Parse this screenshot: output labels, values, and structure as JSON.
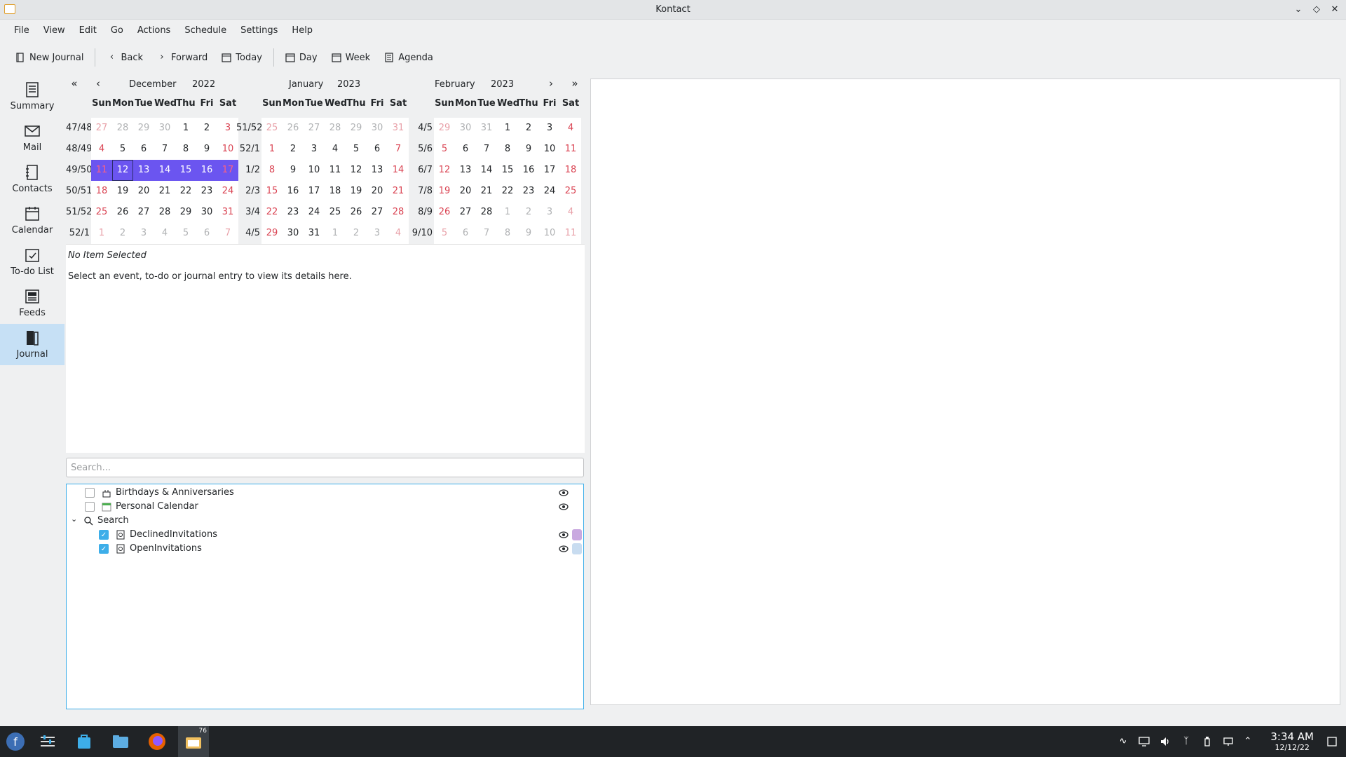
{
  "window": {
    "title": "Kontact"
  },
  "menubar": [
    "File",
    "View",
    "Edit",
    "Go",
    "Actions",
    "Schedule",
    "Settings",
    "Help"
  ],
  "toolbar": {
    "new_journal": "New Journal",
    "back": "Back",
    "forward": "Forward",
    "today": "Today",
    "day": "Day",
    "week": "Week",
    "agenda": "Agenda"
  },
  "sidebar": [
    {
      "label": "Summary",
      "icon": "summary-icon"
    },
    {
      "label": "Mail",
      "icon": "mail-icon"
    },
    {
      "label": "Contacts",
      "icon": "contacts-icon"
    },
    {
      "label": "Calendar",
      "icon": "calendar-icon"
    },
    {
      "label": "To-do List",
      "icon": "todo-icon"
    },
    {
      "label": "Feeds",
      "icon": "feeds-icon"
    },
    {
      "label": "Journal",
      "icon": "journal-icon",
      "active": true
    }
  ],
  "calendar": {
    "dow": [
      "Sun",
      "Mon",
      "Tue",
      "Wed",
      "Thu",
      "Fri",
      "Sat"
    ],
    "months": [
      {
        "month": "December",
        "year": "2022",
        "weeks": [
          "47/48",
          "48/49",
          "49/50",
          "50/51",
          "51/52",
          "52/1"
        ],
        "days": [
          [
            27,
            28,
            29,
            30,
            1,
            2,
            3
          ],
          [
            4,
            5,
            6,
            7,
            8,
            9,
            10
          ],
          [
            11,
            12,
            13,
            14,
            15,
            16,
            17
          ],
          [
            18,
            19,
            20,
            21,
            22,
            23,
            24
          ],
          [
            25,
            26,
            27,
            28,
            29,
            30,
            31
          ],
          [
            1,
            2,
            3,
            4,
            5,
            6,
            7
          ]
        ],
        "other": [
          [
            1,
            1,
            1,
            1,
            0,
            0,
            0
          ],
          [
            0,
            0,
            0,
            0,
            0,
            0,
            0
          ],
          [
            0,
            0,
            0,
            0,
            0,
            0,
            0
          ],
          [
            0,
            0,
            0,
            0,
            0,
            0,
            0
          ],
          [
            0,
            0,
            0,
            0,
            0,
            0,
            0
          ],
          [
            1,
            1,
            1,
            1,
            1,
            1,
            1
          ]
        ],
        "selected_row": 2,
        "today": [
          2,
          1
        ]
      },
      {
        "month": "January",
        "year": "2023",
        "weeks": [
          "51/52",
          "52/1",
          "1/2",
          "2/3",
          "3/4",
          "4/5"
        ],
        "days": [
          [
            25,
            26,
            27,
            28,
            29,
            30,
            31
          ],
          [
            1,
            2,
            3,
            4,
            5,
            6,
            7
          ],
          [
            8,
            9,
            10,
            11,
            12,
            13,
            14
          ],
          [
            15,
            16,
            17,
            18,
            19,
            20,
            21
          ],
          [
            22,
            23,
            24,
            25,
            26,
            27,
            28
          ],
          [
            29,
            30,
            31,
            1,
            2,
            3,
            4
          ]
        ],
        "other": [
          [
            1,
            1,
            1,
            1,
            1,
            1,
            1
          ],
          [
            0,
            0,
            0,
            0,
            0,
            0,
            0
          ],
          [
            0,
            0,
            0,
            0,
            0,
            0,
            0
          ],
          [
            0,
            0,
            0,
            0,
            0,
            0,
            0
          ],
          [
            0,
            0,
            0,
            0,
            0,
            0,
            0
          ],
          [
            0,
            0,
            0,
            1,
            1,
            1,
            1
          ]
        ],
        "selected_row": -1,
        "today": null
      },
      {
        "month": "February",
        "year": "2023",
        "weeks": [
          "4/5",
          "5/6",
          "6/7",
          "7/8",
          "8/9",
          "9/10"
        ],
        "days": [
          [
            29,
            30,
            31,
            1,
            2,
            3,
            4
          ],
          [
            5,
            6,
            7,
            8,
            9,
            10,
            11
          ],
          [
            12,
            13,
            14,
            15,
            16,
            17,
            18
          ],
          [
            19,
            20,
            21,
            22,
            23,
            24,
            25
          ],
          [
            26,
            27,
            28,
            1,
            2,
            3,
            4
          ],
          [
            5,
            6,
            7,
            8,
            9,
            10,
            11
          ]
        ],
        "other": [
          [
            1,
            1,
            1,
            0,
            0,
            0,
            0
          ],
          [
            0,
            0,
            0,
            0,
            0,
            0,
            0
          ],
          [
            0,
            0,
            0,
            0,
            0,
            0,
            0
          ],
          [
            0,
            0,
            0,
            0,
            0,
            0,
            0
          ],
          [
            0,
            0,
            0,
            1,
            1,
            1,
            1
          ],
          [
            1,
            1,
            1,
            1,
            1,
            1,
            1
          ]
        ],
        "selected_row": -1,
        "today": null
      }
    ]
  },
  "details": {
    "header": "No Item Selected",
    "message": "Select an event, to-do or journal entry to view its details here."
  },
  "search": {
    "placeholder": "Search..."
  },
  "tree": [
    {
      "label": "Birthdays & Anniversaries",
      "checked": false,
      "indent": 1,
      "icon": "birthday-icon",
      "eye": true,
      "color": null
    },
    {
      "label": "Personal Calendar",
      "checked": false,
      "indent": 1,
      "icon": "calendar-small-icon",
      "eye": true,
      "color": null
    },
    {
      "label": "Search",
      "checkbox": false,
      "indent": 0,
      "icon": "search-icon",
      "eye": false,
      "color": null,
      "expander": true
    },
    {
      "label": "DeclinedInvitations",
      "checked": true,
      "indent": 2,
      "icon": "saved-search-icon",
      "eye": true,
      "color": "#c9a9e0"
    },
    {
      "label": "OpenInvitations",
      "checked": true,
      "indent": 2,
      "icon": "saved-search-icon",
      "eye": true,
      "color": "#c8dcf0"
    }
  ],
  "taskbar": {
    "time": "3:34 AM",
    "date": "12/12/22",
    "kontact_badge": "76"
  }
}
